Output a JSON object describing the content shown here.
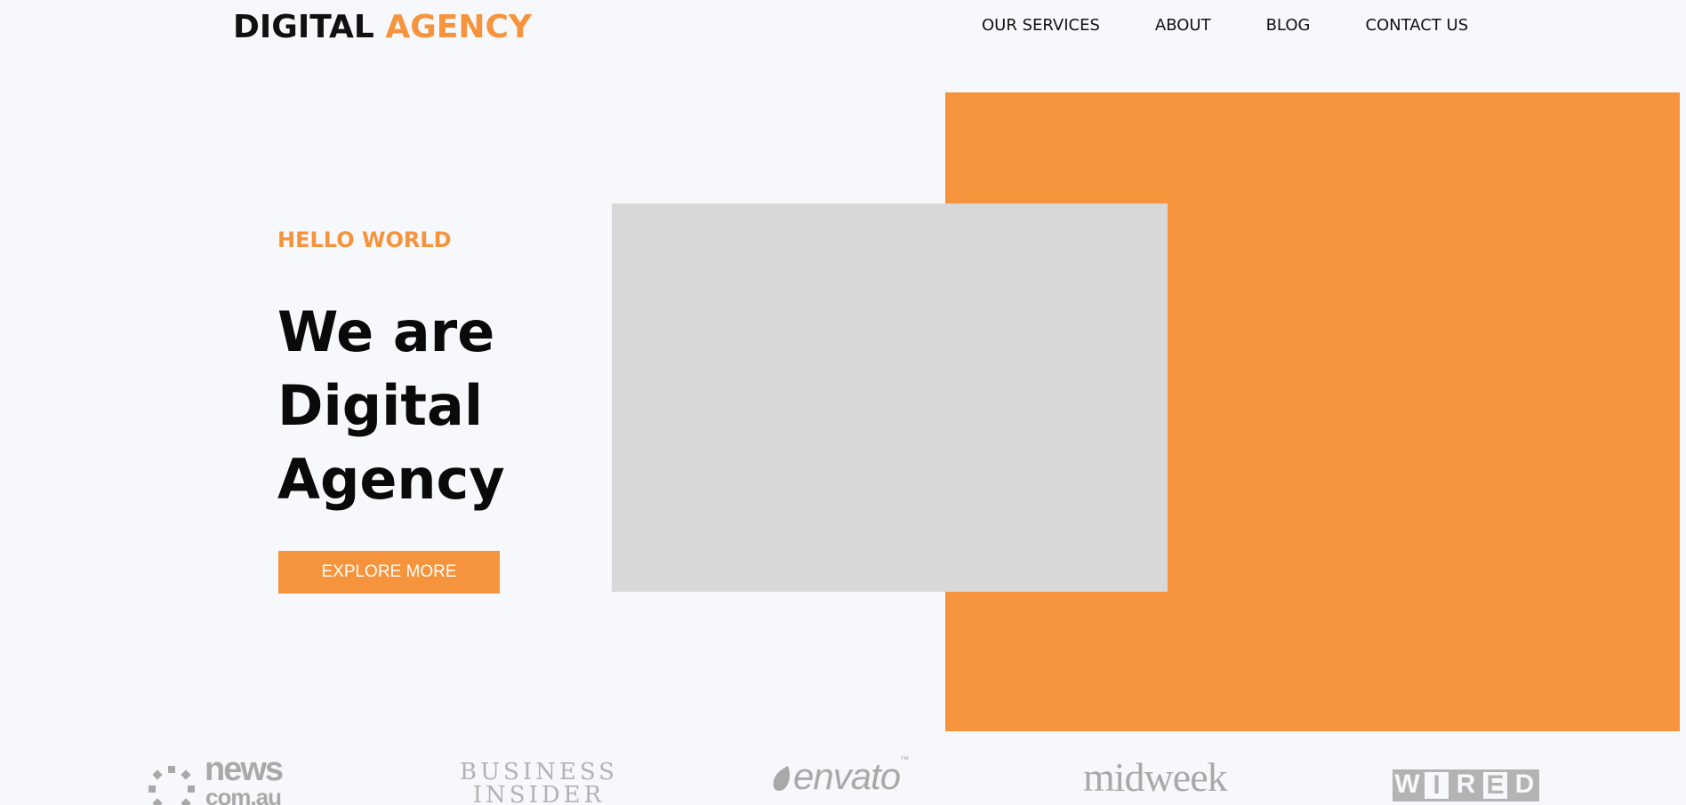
{
  "header": {
    "logo_primary": "DIGITAL",
    "logo_accent": "AGENCY",
    "nav": [
      {
        "label": "OUR SERVICES"
      },
      {
        "label": "ABOUT"
      },
      {
        "label": "BLOG"
      },
      {
        "label": "CONTACT US"
      }
    ]
  },
  "hero": {
    "eyebrow": "HELLO WORLD",
    "headline_lines": [
      "We are",
      "Digital",
      "Agency"
    ],
    "cta_label": "EXPLORE MORE"
  },
  "press": {
    "news": {
      "word": "news",
      "sub": "com.au"
    },
    "business_insider": {
      "line1": "BUSINESS",
      "line2": "INSIDER"
    },
    "envato": {
      "word": "envato",
      "tm": "™"
    },
    "midweek": {
      "word": "midweek"
    },
    "wired": {
      "letters": [
        "W",
        "I",
        "R",
        "E",
        "D"
      ]
    }
  },
  "colors": {
    "accent": "#f5943c",
    "background": "#f7f8fb",
    "image_placeholder": "#d8d8d8",
    "press_logo": "#a9a9a9"
  }
}
